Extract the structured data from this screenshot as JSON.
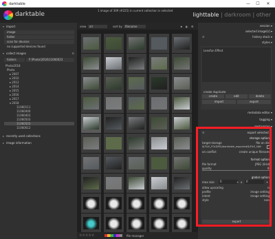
{
  "window": {
    "title": "darktable",
    "app_icon": "darktable-logo-icon",
    "minimize": "—",
    "maximize": "☐",
    "close": "✕"
  },
  "app": {
    "name": "darktable",
    "status": "1 image of 309 (#225) in current collection is selected"
  },
  "views": {
    "lighttable": "lighttable",
    "sep1": "|",
    "darkroom": "darkroom",
    "sep2": "|",
    "other": "other"
  },
  "left": {
    "import": {
      "title": "import",
      "items": [
        "image",
        "folder",
        "scan for devices",
        "no supported devices found"
      ]
    },
    "collect": {
      "title": "collect images",
      "filter_field": "folders",
      "filter_value": "F:\\Photo\\2018\\11060023",
      "root": "Photo2018",
      "group": "Photo",
      "years": [
        "2007",
        "2010",
        "2013",
        "2014",
        "2015",
        "2016",
        "2017",
        "2018"
      ],
      "folders": [
        "11060111",
        "11060400",
        "11060403",
        "11060503",
        "11060503",
        "11060612"
      ],
      "selected_folder_index": 4
    },
    "recent": "recently used collections",
    "info": "image information"
  },
  "center": {
    "view_label": "view",
    "view_value": "all",
    "sort_label": "sort by",
    "sort_value": "filename",
    "star_row": "☆☆☆☆☆",
    "bottom_mode": "file manager",
    "top_icons": {
      "star": "★",
      "circle": "◐",
      "gear": "⚙"
    }
  },
  "thumbs_palette": [
    "#6b6f73",
    "#5a5e54",
    "#7a7c7d",
    "#4c5a3e",
    "#5d6b4a",
    "#3d4a35",
    "#737373",
    "#2b3a2b",
    "#c8cbd0",
    "#555a5f",
    "#8a8d8f",
    "#202020"
  ],
  "right": {
    "session": "session",
    "selected": "selected image[s]",
    "history": "history stack",
    "styles": "styles",
    "tag": "Lensfun Effect",
    "create_duplicate": "create duplicate",
    "create": "create",
    "edit": "edit",
    "delete": "delete",
    "import": "import",
    "export": "export",
    "metadata": "metadata editor",
    "tagging": "tagging",
    "geotagging": "geotagging",
    "export_title": "export selected",
    "storage_options": "storage options",
    "target_storage": "target storage",
    "storage_value": "file on disk",
    "path": "$(FILE_FOLDER)/darktable_exported/$(FILE_NAME)",
    "on_conflict": "on conflict",
    "conflict_value": "create unique filename",
    "format_options": "format options",
    "file_format": "file format",
    "format_value": "JPEG (8-bit)",
    "quality": "quality",
    "quality_value": "95",
    "global_options": "global options",
    "max_size": "max size",
    "max_w": "0",
    "x": "x",
    "max_h": "0",
    "allow_upscaling": "allow upscaling",
    "upscaling_value": "no",
    "profile": "profile",
    "profile_value": "image settings",
    "intent": "intent",
    "intent_value": "image settings",
    "style": "style",
    "style_value": "none",
    "export_button": "export"
  }
}
